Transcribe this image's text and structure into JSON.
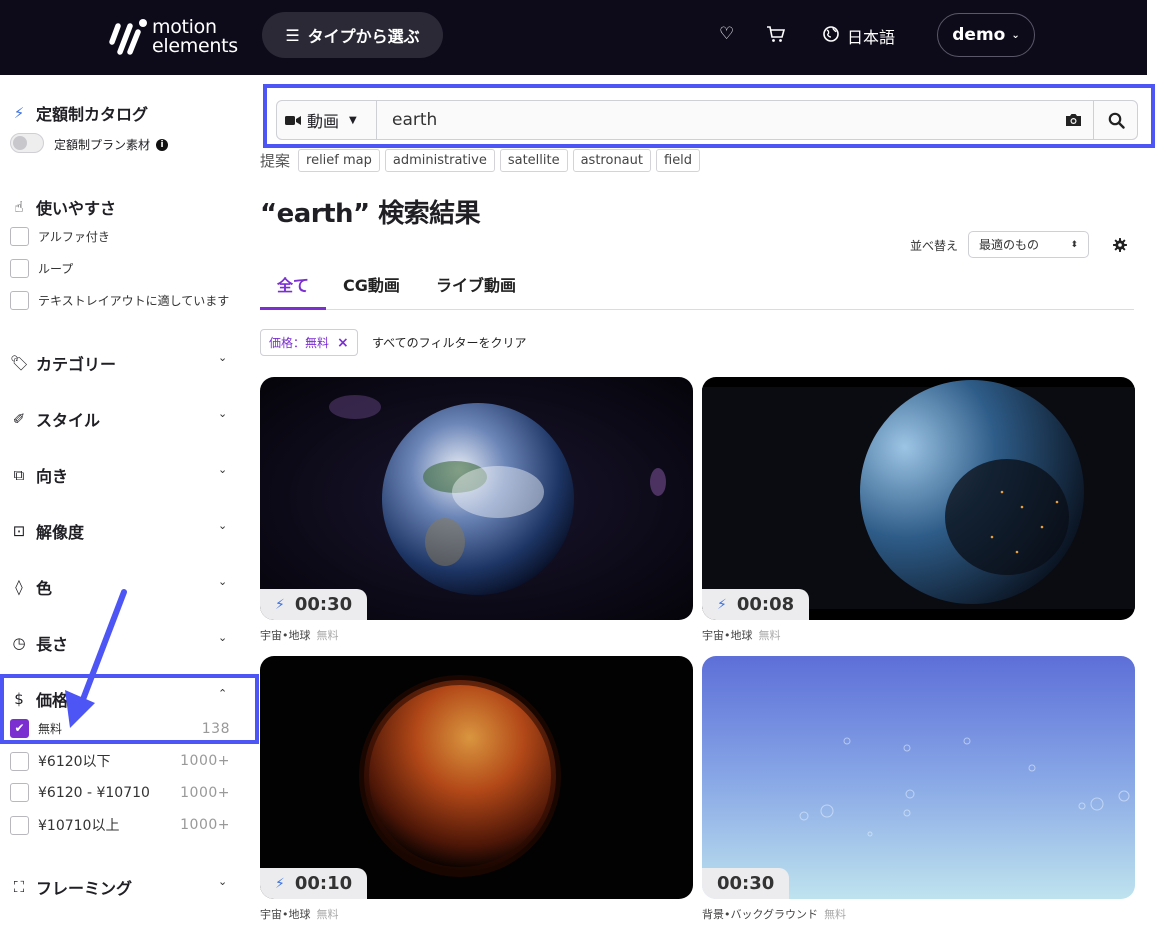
{
  "header": {
    "logo_line1": "motion",
    "logo_line2": "elements",
    "type_button": "タイプから選ぶ",
    "language": "日本語",
    "user": "demo"
  },
  "sidebar": {
    "subscription": {
      "title": "定額制カタログ",
      "toggle_label": "定額制プラン素材"
    },
    "usability": {
      "title": "使いやすさ",
      "options": [
        "アルファ付き",
        "ループ",
        "テキストレイアウトに適しています"
      ]
    },
    "sections": [
      "カテゴリー",
      "スタイル",
      "向き",
      "解像度",
      "色",
      "長さ"
    ],
    "price": {
      "title": "価格",
      "options": [
        {
          "label": "無料",
          "count": "138",
          "checked": true
        },
        {
          "label": "¥6120以下",
          "count": "1000+",
          "checked": false
        },
        {
          "label": "¥6120 - ¥10710",
          "count": "1000+",
          "checked": false
        },
        {
          "label": "¥10710以上",
          "count": "1000+",
          "checked": false
        }
      ]
    },
    "framing": {
      "title": "フレーミング"
    }
  },
  "search": {
    "type": "動画",
    "query": "earth"
  },
  "suggestions": {
    "label": "提案",
    "items": [
      "relief map",
      "administrative",
      "satellite",
      "astronaut",
      "field"
    ]
  },
  "results": {
    "title": "“earth” 検索結果",
    "sort_label": "並べ替え",
    "sort_value": "最適のもの"
  },
  "tabs": [
    "全て",
    "CG動画",
    "ライブ動画"
  ],
  "active_filter": "価格：無料",
  "clear_filters": "すべてのフィルターをクリア",
  "cards": [
    {
      "duration": "00:30",
      "category": "宇宙•地球",
      "price": "無料",
      "subscription": true
    },
    {
      "duration": "00:08",
      "category": "宇宙•地球",
      "price": "無料",
      "subscription": true
    },
    {
      "duration": "00:10",
      "category": "宇宙•地球",
      "price": "無料",
      "subscription": true
    },
    {
      "duration": "00:30",
      "category": "背景•バックグラウンド",
      "price": "無料",
      "subscription": false
    }
  ],
  "colors": {
    "accent": "#7b2fd1",
    "header_bg": "#0d0b1a",
    "annotation": "#4d55f5",
    "bolt": "#3e73e0"
  }
}
